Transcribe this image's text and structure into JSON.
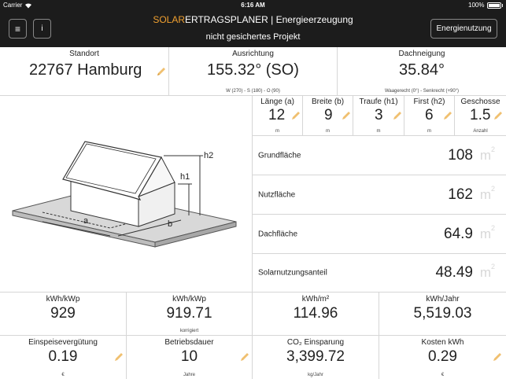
{
  "status": {
    "carrier": "Carrier",
    "time": "6:16 AM",
    "battery": "100%"
  },
  "nav": {
    "brand_part1": "SOLAR",
    "brand_part2": "ERTRAGSPLANER",
    "title_rest": " | Energieerzeugung",
    "subtitle": "nicht gesichertes Projekt",
    "menu_icon": "≡",
    "info_icon": "i",
    "right_button": "Energienutzung"
  },
  "top": {
    "standort": {
      "label": "Standort",
      "value": "22767 Hamburg"
    },
    "ausrichtung": {
      "label": "Ausrichtung",
      "value": "155.32° (SO)",
      "note": "W (270) - S (180) - O (90)"
    },
    "dachneigung": {
      "label": "Dachneigung",
      "value": "35.84°",
      "note": "Waagerecht (0°) - Senkrecht (+90°)"
    }
  },
  "dims": [
    {
      "label": "Länge (a)",
      "value": "12",
      "unit": "m"
    },
    {
      "label": "Breite (b)",
      "value": "9",
      "unit": "m"
    },
    {
      "label": "Traufe (h1)",
      "value": "3",
      "unit": "m"
    },
    {
      "label": "First (h2)",
      "value": "6",
      "unit": "m"
    },
    {
      "label": "Geschosse",
      "value": "1.5",
      "unit": "Anzahl"
    }
  ],
  "areas": [
    {
      "label": "Grundfläche",
      "value": "108",
      "unit": "m",
      "exp": "2"
    },
    {
      "label": "Nutzfläche",
      "value": "162",
      "unit": "m",
      "exp": "2"
    },
    {
      "label": "Dachfläche",
      "value": "64.9",
      "unit": "m",
      "exp": "2"
    },
    {
      "label": "Solarnutzungsanteil",
      "value": "48.49",
      "unit": "m",
      "exp": "2"
    }
  ],
  "figure": {
    "label_a": "a",
    "label_b": "b",
    "label_h1": "h1",
    "label_h2": "h2"
  },
  "results": [
    {
      "label": "kWh/kWp",
      "value": "929",
      "note": ""
    },
    {
      "label": "kWh/kWp",
      "value": "919.71",
      "note": "korrigiert"
    },
    {
      "label": "kWh/m²",
      "value": "114.96",
      "note": ""
    },
    {
      "label": "kWh/Jahr",
      "value": "5,519.03",
      "note": ""
    }
  ],
  "inputs": [
    {
      "label": "Einspeisevergütung",
      "value": "0.19",
      "unit": "€"
    },
    {
      "label": "Betriebsdauer",
      "value": "10",
      "unit": "Jahre"
    },
    {
      "label": "CO₂ Einsparung",
      "value": "3,399.72",
      "unit": "kg/Jahr"
    },
    {
      "label": "Kosten kWh",
      "value": "0.29",
      "unit": "€"
    }
  ],
  "colors": {
    "accent": "#f0a030",
    "bar": "#1c1c1c",
    "pencil": "#f0c070"
  }
}
